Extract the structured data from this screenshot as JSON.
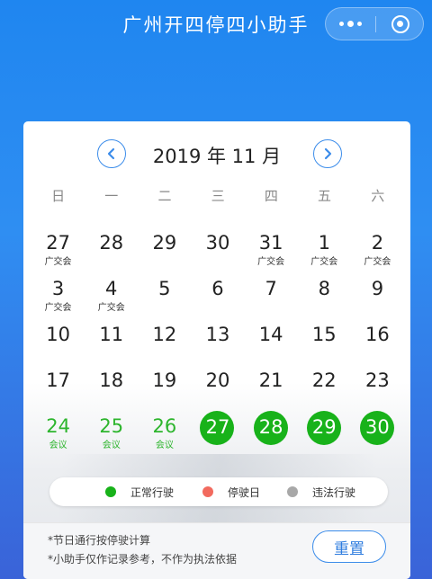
{
  "header": {
    "title": "广州开四停四小助手"
  },
  "calendar": {
    "month_label": "2019 年 11 月",
    "weekdays": [
      "日",
      "一",
      "二",
      "三",
      "四",
      "五",
      "六"
    ],
    "weeks": [
      [
        {
          "d": "27",
          "note": "广交会"
        },
        {
          "d": "28",
          "note": ""
        },
        {
          "d": "29",
          "note": ""
        },
        {
          "d": "30",
          "note": ""
        },
        {
          "d": "31",
          "note": "广交会"
        },
        {
          "d": "1",
          "note": "广交会"
        },
        {
          "d": "2",
          "note": "广交会"
        }
      ],
      [
        {
          "d": "3",
          "note": "广交会"
        },
        {
          "d": "4",
          "note": "广交会"
        },
        {
          "d": "5",
          "note": ""
        },
        {
          "d": "6",
          "note": ""
        },
        {
          "d": "7",
          "note": ""
        },
        {
          "d": "8",
          "note": ""
        },
        {
          "d": "9",
          "note": ""
        }
      ],
      [
        {
          "d": "10",
          "note": ""
        },
        {
          "d": "11",
          "note": ""
        },
        {
          "d": "12",
          "note": ""
        },
        {
          "d": "13",
          "note": ""
        },
        {
          "d": "14",
          "note": ""
        },
        {
          "d": "15",
          "note": ""
        },
        {
          "d": "16",
          "note": ""
        }
      ],
      [
        {
          "d": "17",
          "note": ""
        },
        {
          "d": "18",
          "note": ""
        },
        {
          "d": "19",
          "note": ""
        },
        {
          "d": "20",
          "note": ""
        },
        {
          "d": "21",
          "note": ""
        },
        {
          "d": "22",
          "note": ""
        },
        {
          "d": "23",
          "note": ""
        }
      ],
      [
        {
          "d": "24",
          "note": "会议",
          "style": "green"
        },
        {
          "d": "25",
          "note": "会议",
          "style": "green"
        },
        {
          "d": "26",
          "note": "会议",
          "style": "green"
        },
        {
          "d": "27",
          "note": "",
          "style": "filled"
        },
        {
          "d": "28",
          "note": "",
          "style": "filled"
        },
        {
          "d": "29",
          "note": "",
          "style": "filled"
        },
        {
          "d": "30",
          "note": "",
          "style": "filled"
        }
      ]
    ]
  },
  "legend": [
    {
      "label": "正常行驶",
      "color": "#18b21a"
    },
    {
      "label": "停驶日",
      "color": "#f26a5e"
    },
    {
      "label": "违法行驶",
      "color": "#a8a8a8"
    }
  ],
  "footer": {
    "note1": "*节日通行按停驶计算",
    "note2": "*小助手仅作记录参考，不作为执法依据",
    "reset_label": "重置"
  },
  "colors": {
    "accent": "#3b8cea",
    "green": "#18b21a"
  }
}
